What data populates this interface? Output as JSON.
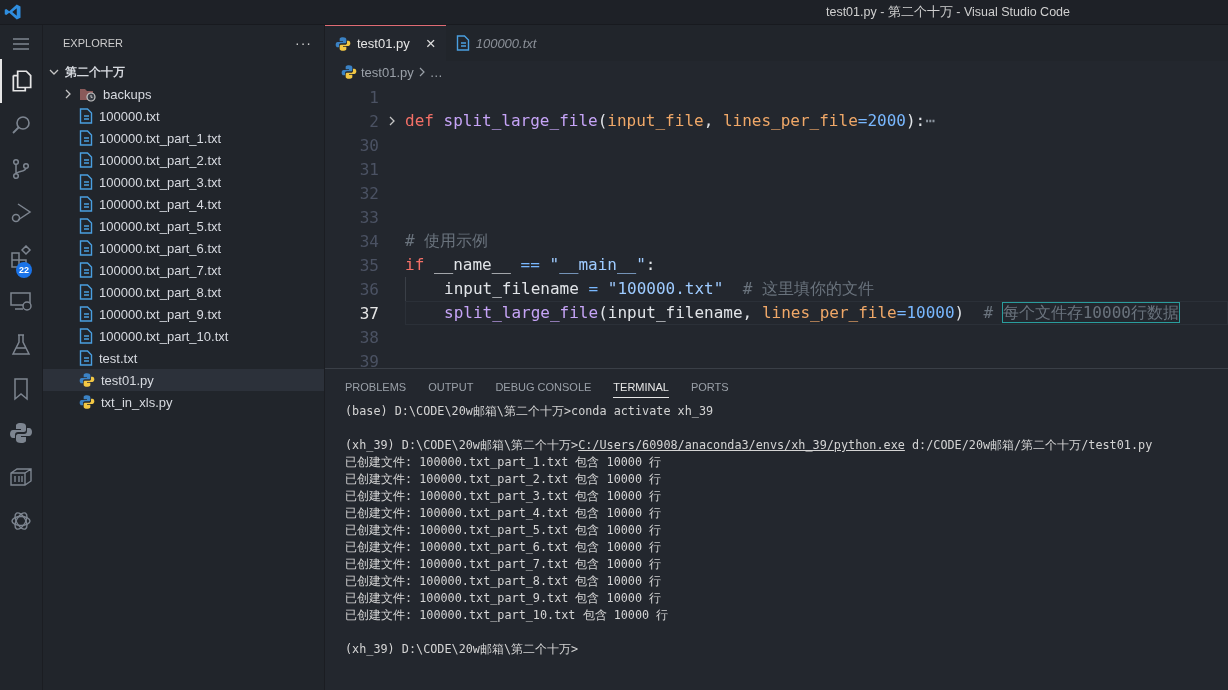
{
  "window": {
    "title": "test01.py - 第二个十万 - Visual Studio Code"
  },
  "activity_bar": [
    {
      "kind": "explorer",
      "selected": true
    },
    {
      "kind": "search",
      "selected": false
    },
    {
      "kind": "source-control",
      "selected": false
    },
    {
      "kind": "run-debug",
      "selected": false
    },
    {
      "kind": "extensions",
      "selected": false,
      "badge": "22"
    },
    {
      "kind": "remote",
      "selected": false
    },
    {
      "kind": "testing",
      "selected": false
    },
    {
      "kind": "bookmarks",
      "selected": false
    },
    {
      "kind": "python",
      "selected": false
    },
    {
      "kind": "containers",
      "selected": false
    },
    {
      "kind": "chat",
      "selected": false
    }
  ],
  "sidebar": {
    "title": "EXPLORER",
    "more": "···",
    "root": {
      "label": "第二个十万",
      "expanded": true,
      "children": [
        {
          "label": "backups",
          "kind": "folder",
          "expanded": false,
          "selected": false
        },
        {
          "label": "100000.txt",
          "kind": "txt",
          "selected": false
        },
        {
          "label": "100000.txt_part_1.txt",
          "kind": "txt",
          "selected": false
        },
        {
          "label": "100000.txt_part_2.txt",
          "kind": "txt",
          "selected": false
        },
        {
          "label": "100000.txt_part_3.txt",
          "kind": "txt",
          "selected": false
        },
        {
          "label": "100000.txt_part_4.txt",
          "kind": "txt",
          "selected": false
        },
        {
          "label": "100000.txt_part_5.txt",
          "kind": "txt",
          "selected": false
        },
        {
          "label": "100000.txt_part_6.txt",
          "kind": "txt",
          "selected": false
        },
        {
          "label": "100000.txt_part_7.txt",
          "kind": "txt",
          "selected": false
        },
        {
          "label": "100000.txt_part_8.txt",
          "kind": "txt",
          "selected": false
        },
        {
          "label": "100000.txt_part_9.txt",
          "kind": "txt",
          "selected": false
        },
        {
          "label": "100000.txt_part_10.txt",
          "kind": "txt",
          "selected": false
        },
        {
          "label": "test.txt",
          "kind": "txt",
          "selected": false
        },
        {
          "label": "test01.py",
          "kind": "py",
          "selected": true
        },
        {
          "label": "txt_in_xls.py",
          "kind": "py",
          "selected": false
        }
      ]
    }
  },
  "tabs": [
    {
      "label": "test01.py",
      "kind": "py",
      "selected": true,
      "preview": false,
      "close": "×"
    },
    {
      "label": "100000.txt",
      "kind": "txt",
      "selected": false,
      "preview": true
    }
  ],
  "breadcrumb": [
    {
      "label": "test01.py",
      "kind": "py"
    },
    {
      "label": "…",
      "kind": "more"
    }
  ],
  "code_lines": [
    {
      "number": "1",
      "current": false,
      "folded": false
    },
    {
      "number": "2",
      "current": false,
      "folded": true,
      "indented": false,
      "tokens": [
        {
          "text": "def",
          "kind": "kw"
        },
        {
          "text": " split_large_file",
          "kind": "fn"
        },
        {
          "text": "(",
          "kind": "plain"
        },
        {
          "text": "input_file",
          "kind": "param"
        },
        {
          "text": ", ",
          "kind": "plain"
        },
        {
          "text": "lines_per_file",
          "kind": "param"
        },
        {
          "text": "=",
          "kind": "op"
        },
        {
          "text": "2000",
          "kind": "num"
        },
        {
          "text": "):",
          "kind": "plain"
        },
        {
          "text": "⋯",
          "kind": "ellipsis"
        }
      ]
    },
    {
      "number": "30",
      "current": false,
      "folded": false
    },
    {
      "number": "31",
      "current": false,
      "folded": false
    },
    {
      "number": "32",
      "current": false,
      "folded": false
    },
    {
      "number": "33",
      "current": false,
      "folded": false
    },
    {
      "number": "34",
      "current": false,
      "folded": false,
      "indented": false,
      "tokens": [
        {
          "text": "# 使用示例",
          "kind": "comment"
        }
      ]
    },
    {
      "number": "35",
      "current": false,
      "folded": false,
      "indented": false,
      "tokens": [
        {
          "text": "if",
          "kind": "kw"
        },
        {
          "text": " __name__ ",
          "kind": "plain"
        },
        {
          "text": "==",
          "kind": "op"
        },
        {
          "text": " \"__main__\"",
          "kind": "str"
        },
        {
          "text": ":",
          "kind": "plain"
        }
      ]
    },
    {
      "number": "36",
      "current": false,
      "folded": false,
      "indented": true,
      "tokens": [
        {
          "text": "input_filename",
          "kind": "plain"
        },
        {
          "text": " = ",
          "kind": "op"
        },
        {
          "text": "\"100000.txt\"",
          "kind": "str"
        },
        {
          "text": "  # 这里填你的文件",
          "kind": "comment"
        }
      ]
    },
    {
      "number": "37",
      "current": true,
      "folded": false,
      "indented": true,
      "tokens": [
        {
          "text": "split_large_file",
          "kind": "fn"
        },
        {
          "text": "(input_filename, ",
          "kind": "plain"
        },
        {
          "text": "lines_per_file",
          "kind": "param"
        },
        {
          "text": "=",
          "kind": "op"
        },
        {
          "text": "10000",
          "kind": "num"
        },
        {
          "text": ")  ",
          "kind": "plain"
        },
        {
          "text": "# ",
          "kind": "comment"
        },
        {
          "text": "每个文件存10000行数据",
          "kind": "highlight"
        }
      ]
    },
    {
      "number": "38",
      "current": false,
      "folded": false
    },
    {
      "number": "39",
      "current": false,
      "folded": false
    }
  ],
  "panel_tabs": [
    {
      "label": "PROBLEMS",
      "selected": false
    },
    {
      "label": "OUTPUT",
      "selected": false
    },
    {
      "label": "DEBUG CONSOLE",
      "selected": false
    },
    {
      "label": "TERMINAL",
      "selected": true
    },
    {
      "label": "PORTS",
      "selected": false
    }
  ],
  "terminal": [
    [
      {
        "parts": [
          {
            "text": "(base) D:\\CODE\\20w邮箱\\第二个十万>conda activate xh_39",
            "kind": "text"
          }
        ]
      }
    ],
    [
      {
        "parts": [
          {
            "text": "(xh_39) D:\\CODE\\20w邮箱\\第二个十万>",
            "kind": "text"
          },
          {
            "text": "C:/Users/60908/anaconda3/envs/xh_39/python.exe",
            "kind": "link"
          },
          {
            "text": " d:/CODE/20w邮箱/第二个十万/test01.py",
            "kind": "text"
          }
        ]
      },
      {
        "parts": [
          {
            "text": "已创建文件: 100000.txt_part_1.txt 包含 10000 行",
            "kind": "text"
          }
        ]
      },
      {
        "parts": [
          {
            "text": "已创建文件: 100000.txt_part_2.txt 包含 10000 行",
            "kind": "text"
          }
        ]
      },
      {
        "parts": [
          {
            "text": "已创建文件: 100000.txt_part_3.txt 包含 10000 行",
            "kind": "text"
          }
        ]
      },
      {
        "parts": [
          {
            "text": "已创建文件: 100000.txt_part_4.txt 包含 10000 行",
            "kind": "text"
          }
        ]
      },
      {
        "parts": [
          {
            "text": "已创建文件: 100000.txt_part_5.txt 包含 10000 行",
            "kind": "text"
          }
        ]
      },
      {
        "parts": [
          {
            "text": "已创建文件: 100000.txt_part_6.txt 包含 10000 行",
            "kind": "text"
          }
        ]
      },
      {
        "parts": [
          {
            "text": "已创建文件: 100000.txt_part_7.txt 包含 10000 行",
            "kind": "text"
          }
        ]
      },
      {
        "parts": [
          {
            "text": "已创建文件: 100000.txt_part_8.txt 包含 10000 行",
            "kind": "text"
          }
        ]
      },
      {
        "parts": [
          {
            "text": "已创建文件: 100000.txt_part_9.txt 包含 10000 行",
            "kind": "text"
          }
        ]
      },
      {
        "parts": [
          {
            "text": "已创建文件: 100000.txt_part_10.txt 包含 10000 行",
            "kind": "text"
          }
        ]
      }
    ],
    [
      {
        "parts": [
          {
            "text": "(xh_39) D:\\CODE\\20w邮箱\\第二个十万>",
            "kind": "text"
          }
        ]
      }
    ]
  ]
}
